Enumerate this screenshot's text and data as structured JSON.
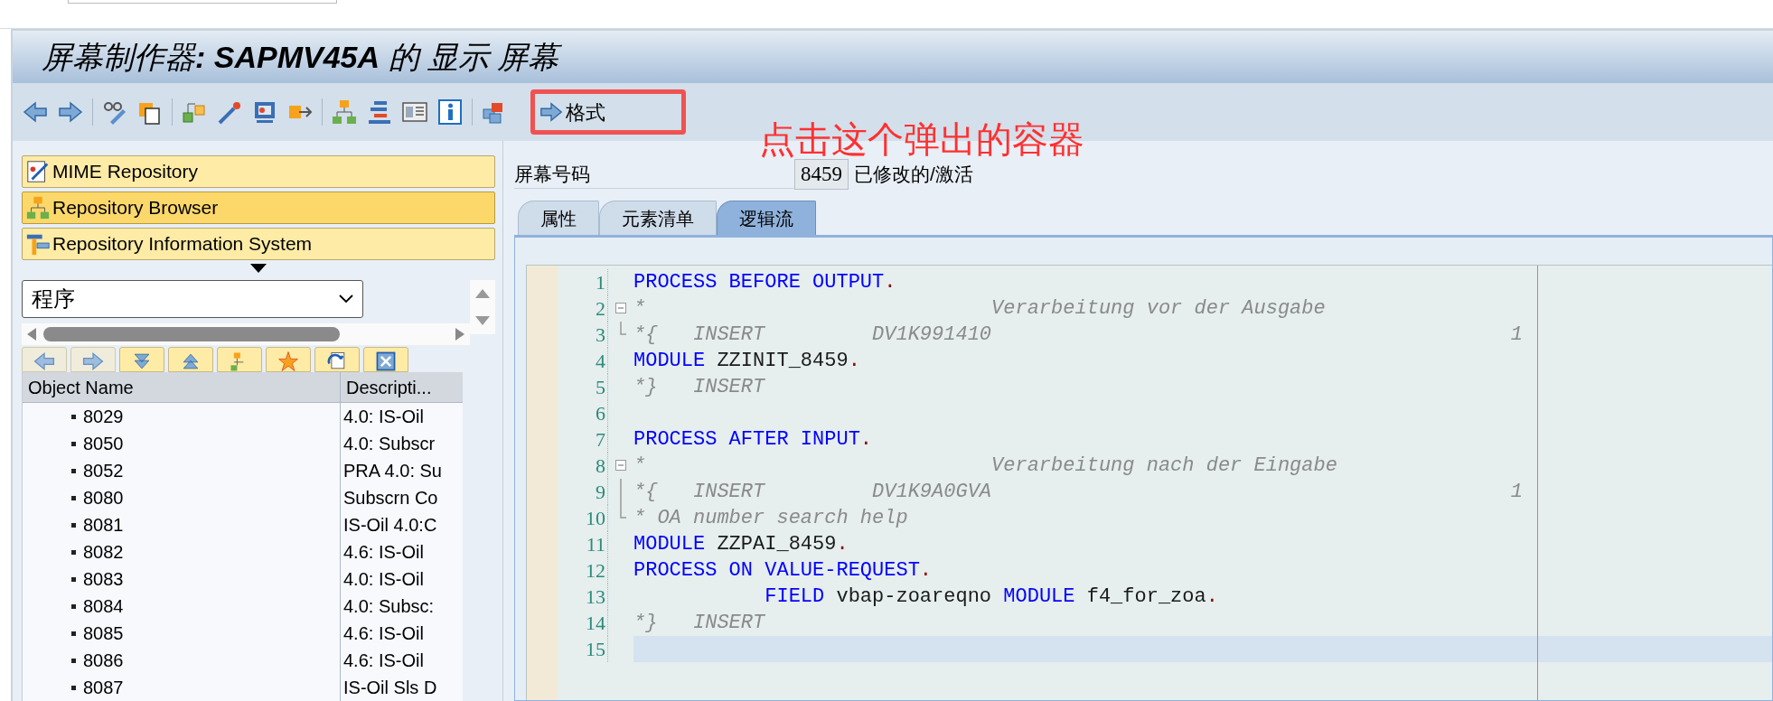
{
  "title": "屏幕制作器**: SAPMV45A** 的 显示 屏幕",
  "toolbar": {
    "format_button": "格式"
  },
  "annotation": {
    "text": "点击这个弹出的容器"
  },
  "navigator": {
    "buttons": [
      {
        "label": "MIME Repository",
        "selected": false
      },
      {
        "label": "Repository Browser",
        "selected": true
      },
      {
        "label": "Repository Information System",
        "selected": false
      }
    ],
    "object_type": {
      "value": "程序"
    },
    "table": {
      "columns": [
        "Object Name",
        "Descripti..."
      ],
      "rows": [
        {
          "name": "8029",
          "description": "4.0: IS-Oil"
        },
        {
          "name": "8050",
          "description": "4.0: Subscr"
        },
        {
          "name": "8052",
          "description": "PRA 4.0: Su"
        },
        {
          "name": "8080",
          "description": "Subscrn Co"
        },
        {
          "name": "8081",
          "description": "IS-Oil 4.0:C"
        },
        {
          "name": "8082",
          "description": "4.6: IS-Oil"
        },
        {
          "name": "8083",
          "description": "4.0: IS-Oil"
        },
        {
          "name": "8084",
          "description": "4.0: Subsc:"
        },
        {
          "name": "8085",
          "description": "4.6: IS-Oil"
        },
        {
          "name": "8086",
          "description": "4.6: IS-Oil"
        },
        {
          "name": "8087",
          "description": "IS-Oil Sls D"
        }
      ]
    }
  },
  "screen": {
    "number_label": "屏幕号码",
    "number": "8459",
    "status": "已修改的/激活",
    "tabs": [
      {
        "label": "属性",
        "selected": false
      },
      {
        "label": "元素清单",
        "selected": false
      },
      {
        "label": "逻辑流",
        "selected": true
      }
    ],
    "editor": {
      "lines": [
        {
          "number": "1",
          "kind": "plain",
          "current": false,
          "tokens": [
            {
              "kind": "keyword",
              "text": "PROCESS BEFORE OUTPUT"
            },
            {
              "kind": "punct",
              "text": "."
            }
          ]
        },
        {
          "number": "2",
          "kind": "foldhead",
          "current": false,
          "tokens": [
            {
              "kind": "comment",
              "text": "*                             Verarbeitung vor der Ausgabe"
            }
          ]
        },
        {
          "number": "3",
          "kind": "foldtail",
          "current": false,
          "tokens": [
            {
              "kind": "comment",
              "text": "*{   INSERT         DV1K991410"
            },
            {
              "kind": "count",
              "text": "1"
            }
          ]
        },
        {
          "number": "4",
          "kind": "plain",
          "current": false,
          "tokens": [
            {
              "kind": "keyword",
              "text": "MODULE"
            },
            {
              "kind": "ident",
              "text": " ZZINIT_8459"
            },
            {
              "kind": "punct",
              "text": "."
            }
          ]
        },
        {
          "number": "5",
          "kind": "plain",
          "current": false,
          "tokens": [
            {
              "kind": "comment",
              "text": "*}   INSERT"
            }
          ]
        },
        {
          "number": "6",
          "kind": "plain",
          "current": false
        },
        {
          "number": "7",
          "kind": "plain",
          "current": false,
          "tokens": [
            {
              "kind": "keyword",
              "text": "PROCESS AFTER INPUT"
            },
            {
              "kind": "punct",
              "text": "."
            }
          ]
        },
        {
          "number": "8",
          "kind": "foldhead",
          "current": false,
          "tokens": [
            {
              "kind": "comment",
              "text": "*                             Verarbeitung nach der Eingabe"
            }
          ]
        },
        {
          "number": "9",
          "kind": "foldbody",
          "current": false,
          "tokens": [
            {
              "kind": "comment",
              "text": "*{   INSERT         DV1K9A0GVA"
            },
            {
              "kind": "count",
              "text": "1"
            }
          ]
        },
        {
          "number": "10",
          "kind": "foldtail",
          "current": false,
          "tokens": [
            {
              "kind": "comment",
              "text": "* OA number search help"
            }
          ]
        },
        {
          "number": "11",
          "kind": "plain",
          "current": false,
          "tokens": [
            {
              "kind": "keyword",
              "text": "MODULE"
            },
            {
              "kind": "ident",
              "text": " ZZPAI_8459"
            },
            {
              "kind": "punct",
              "text": "."
            }
          ]
        },
        {
          "number": "12",
          "kind": "plain",
          "current": false,
          "tokens": [
            {
              "kind": "keyword",
              "text": "PROCESS ON VALUE-REQUEST"
            },
            {
              "kind": "punct",
              "text": "."
            }
          ]
        },
        {
          "number": "13",
          "kind": "plain",
          "current": false,
          "tokens": [
            {
              "kind": "keyword",
              "text": "           FIELD"
            },
            {
              "kind": "ident",
              "text": " vbap-zoareqno "
            },
            {
              "kind": "keyword",
              "text": "MODULE"
            },
            {
              "kind": "ident",
              "text": " f4_for_zoa"
            },
            {
              "kind": "punct",
              "text": "."
            }
          ]
        },
        {
          "number": "14",
          "kind": "plain",
          "current": false,
          "tokens": [
            {
              "kind": "comment",
              "text": "*}   INSERT"
            }
          ]
        },
        {
          "number": "15",
          "kind": "plain",
          "current": true
        }
      ]
    }
  }
}
